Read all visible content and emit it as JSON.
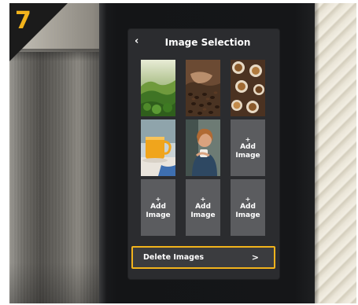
{
  "step": {
    "number": "7",
    "badge_color": "#f2b31c"
  },
  "screen": {
    "title": "Image Selection",
    "back_icon": "chevron-left-icon",
    "tiles": [
      {
        "kind": "image",
        "subject": "green forested mountains"
      },
      {
        "kind": "image",
        "subject": "coffee beans in hands"
      },
      {
        "kind": "image",
        "subject": "coffee cups from above"
      },
      {
        "kind": "image",
        "subject": "yellow coffee mug"
      },
      {
        "kind": "image",
        "subject": "woman drinking coffee"
      },
      {
        "kind": "add",
        "plus": "+",
        "line1": "Add",
        "line2": "Image"
      },
      {
        "kind": "add",
        "plus": "+",
        "line1": "Add",
        "line2": "Image"
      },
      {
        "kind": "add",
        "plus": "+",
        "line1": "Add",
        "line2": "Image"
      },
      {
        "kind": "add",
        "plus": "+",
        "line1": "Add",
        "line2": "Image"
      }
    ],
    "delete_button": {
      "label": "Delete Images",
      "chevron": ">",
      "highlight_color": "#f2b31c"
    }
  }
}
